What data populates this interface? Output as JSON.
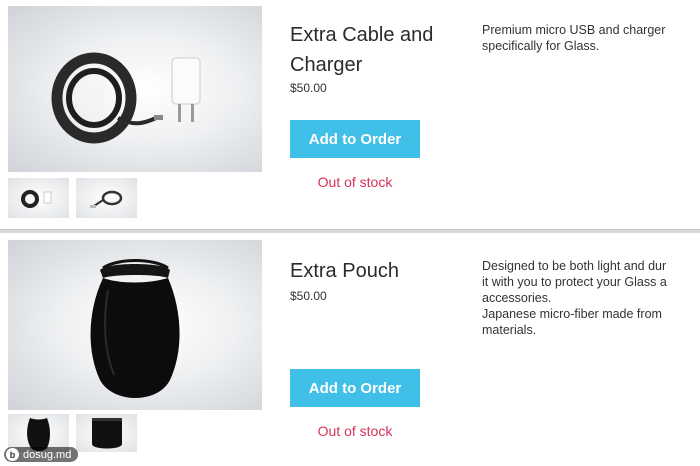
{
  "products": [
    {
      "title": "Extra Cable and Charger",
      "price": "$50.00",
      "button_label": "Add to Order",
      "stock_status": "Out of stock",
      "description": "Premium micro USB and charger\nspecifically for Glass.",
      "hero_icon": "cable-charger-icon",
      "thumbnails": [
        "cable-charger-thumb",
        "cable-thumb"
      ]
    },
    {
      "title": "Extra Pouch",
      "price": "$50.00",
      "button_label": "Add to Order",
      "stock_status": "Out of stock",
      "description": "Designed to be both light and dur\nit with you to protect your Glass a\naccessories.\nJapanese micro-fiber made from\nmaterials.",
      "hero_icon": "pouch-icon",
      "thumbnails": [
        "pouch-thumb",
        "pouch-flat-thumb"
      ]
    }
  ],
  "watermark": {
    "text": "dosug.md",
    "logo_text": "b"
  },
  "colors": {
    "button": "#40bfe8",
    "stock": "#d8325a"
  }
}
